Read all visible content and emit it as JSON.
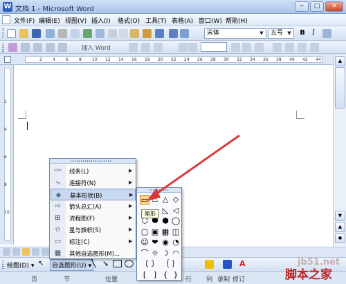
{
  "window": {
    "title": "文档 1 - Microsoft Word",
    "min_label": "─",
    "max_label": "□",
    "close_label": "✕"
  },
  "menubar": {
    "items": [
      "文件(F)",
      "编辑(E)",
      "视图(V)",
      "插入(I)",
      "格式(O)",
      "工具(T)",
      "表格(A)",
      "窗口(W)",
      "帮助(H)"
    ]
  },
  "formatting": {
    "font": "宋体",
    "size": "五号",
    "bold": "B",
    "italic": "I"
  },
  "toolbar2": {
    "insert_word": "插入 Word"
  },
  "ruler": {
    "numbers": [
      "2",
      "4",
      "6",
      "8",
      "10",
      "12",
      "14",
      "16",
      "18",
      "20",
      "22",
      "24",
      "26",
      "28",
      "30",
      "32",
      "34",
      "36",
      "38",
      "40",
      "42",
      "44"
    ]
  },
  "vruler": {
    "numbers": [
      "2",
      "4",
      "6",
      "8",
      "10"
    ]
  },
  "autoshape_menu": {
    "items": [
      {
        "label": "线条(L)",
        "icon": "lines-icon",
        "glyph": "〰",
        "has_submenu": true
      },
      {
        "label": "连接符(N)",
        "icon": "connector-icon",
        "glyph": "⤷",
        "has_submenu": true
      },
      {
        "label": "基本形状(B)",
        "icon": "basic-shapes-icon",
        "glyph": "◈",
        "has_submenu": true
      },
      {
        "label": "箭头总汇(A)",
        "icon": "block-arrows-icon",
        "glyph": "⇨",
        "has_submenu": true
      },
      {
        "label": "流程图(F)",
        "icon": "flowchart-icon",
        "glyph": "⊞",
        "has_submenu": true
      },
      {
        "label": "星与旗帜(S)",
        "icon": "stars-banners-icon",
        "glyph": "✩",
        "has_submenu": true
      },
      {
        "label": "标注(C)",
        "icon": "callouts-icon",
        "glyph": "▭",
        "has_submenu": true
      },
      {
        "label": "其他自选图形(M)...",
        "icon": "more-autoshapes-icon",
        "glyph": "▦",
        "has_submenu": false
      }
    ],
    "highlighted_index": 2,
    "submenu_arrow": "▶"
  },
  "basic_shapes": {
    "tooltip": "矩形",
    "glyphs": [
      "▭",
      "⏢",
      "△",
      "◇",
      "▱",
      "▭",
      "◺",
      "◁",
      "⬡",
      "⯃",
      "⬢",
      "◯",
      "▢",
      "▣",
      "▦",
      "◫",
      "☺",
      "❤",
      "◉",
      "◔",
      "⌒",
      "☼",
      "☽",
      "◠",
      "〔",
      "〕",
      "｛",
      "｝",
      "[",
      "]",
      "{",
      "}"
    ],
    "selected_index": 0
  },
  "drawing_toolbar": {
    "draw_label": "绘图(D) ▾",
    "autoshape_label": "自选图形(U) ▾"
  },
  "statusbar": {
    "items": [
      "页",
      "节",
      "位置",
      "行",
      "列",
      "录制",
      "修订"
    ]
  },
  "watermark": {
    "site": "jb51.net",
    "brand": "脚本之家"
  },
  "colors": {
    "accent_arrow": "#d83a3a",
    "highlight": "#c8d8f0"
  }
}
